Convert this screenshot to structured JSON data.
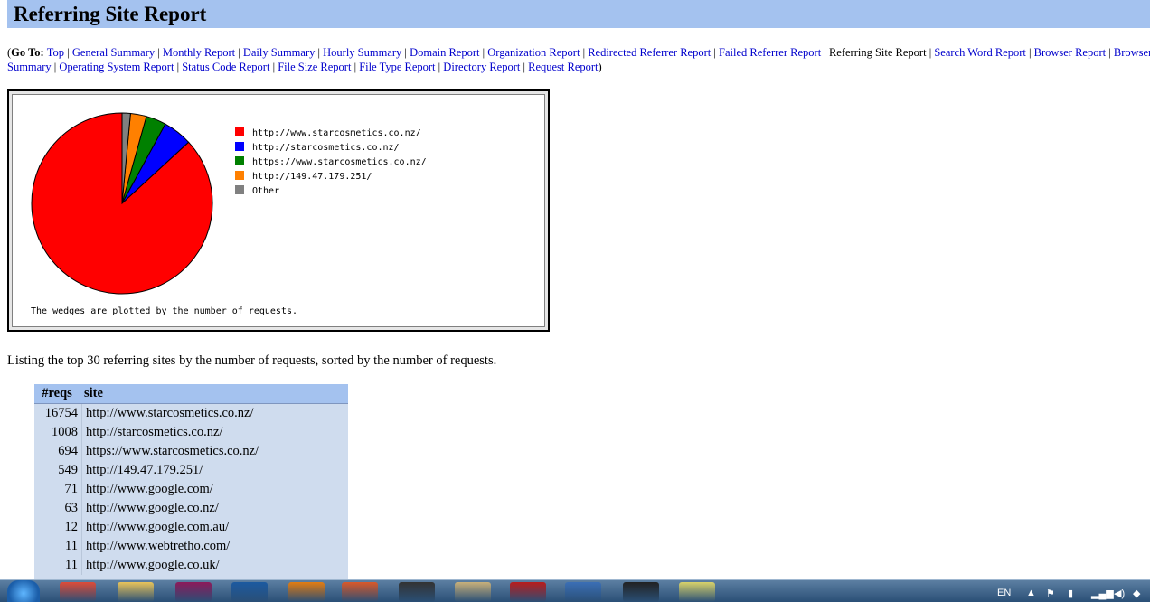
{
  "header": {
    "title": "Referring Site Report"
  },
  "goto": {
    "prefix": "(",
    "label": "Go To",
    "colon": ":",
    "suffix": ")",
    "separator": " | ",
    "line1": [
      {
        "label": "Top",
        "link": true
      },
      {
        "label": "General Summary",
        "link": true
      },
      {
        "label": "Monthly Report",
        "link": true
      },
      {
        "label": "Daily Summary",
        "link": true
      },
      {
        "label": "Hourly Summary",
        "link": true
      },
      {
        "label": "Domain Report",
        "link": true
      },
      {
        "label": "Organization Report",
        "link": true
      },
      {
        "label": "Redirected Referrer Report",
        "link": true
      },
      {
        "label": "Failed Referrer Report",
        "link": true
      },
      {
        "label": "Referring Site Report",
        "link": false
      },
      {
        "label": "Search Word Report",
        "link": true
      },
      {
        "label": "Browser Report",
        "link": true
      },
      {
        "label": "Browser",
        "link": true
      }
    ],
    "line2": [
      {
        "label": "Summary",
        "link": true
      },
      {
        "label": "Operating System Report",
        "link": true
      },
      {
        "label": "Status Code Report",
        "link": true
      },
      {
        "label": "File Size Report",
        "link": true
      },
      {
        "label": "File Type Report",
        "link": true
      },
      {
        "label": "Directory Report",
        "link": true
      },
      {
        "label": "Request Report",
        "link": true
      }
    ]
  },
  "chart_data": {
    "type": "pie",
    "title": "",
    "note": "The wedges are plotted by the number of requests.",
    "slices": [
      {
        "label": "http://www.starcosmetics.co.nz/",
        "value": 16754,
        "color": "#ff0000"
      },
      {
        "label": "http://starcosmetics.co.nz/",
        "value": 1008,
        "color": "#0000ff"
      },
      {
        "label": "https://www.starcosmetics.co.nz/",
        "value": 694,
        "color": "#008000"
      },
      {
        "label": "http://149.47.179.251/",
        "value": 549,
        "color": "#ff8000"
      },
      {
        "label": "Other",
        "value": 289,
        "color": "#808080"
      }
    ]
  },
  "intro": "Listing the top 30 referring sites by the number of requests, sorted by the number of requests.",
  "table": {
    "headers": [
      "#reqs",
      "site"
    ],
    "rows": [
      {
        "reqs": "16754",
        "site": "http://www.starcosmetics.co.nz/"
      },
      {
        "reqs": "1008",
        "site": "http://starcosmetics.co.nz/"
      },
      {
        "reqs": "694",
        "site": "https://www.starcosmetics.co.nz/"
      },
      {
        "reqs": "549",
        "site": "http://149.47.179.251/"
      },
      {
        "reqs": "71",
        "site": "http://www.google.com/"
      },
      {
        "reqs": "63",
        "site": "http://www.google.co.nz/"
      },
      {
        "reqs": "12",
        "site": "http://www.google.com.au/"
      },
      {
        "reqs": "11",
        "site": "http://www.webtretho.com/"
      },
      {
        "reqs": "11",
        "site": "http://www.google.co.uk/"
      }
    ]
  },
  "taskbar": {
    "language": "EN",
    "apps": [
      {
        "name": "chrome-icon",
        "color": "#dd4b39"
      },
      {
        "name": "folder-icon",
        "color": "#e8c45a"
      },
      {
        "name": "indesign-icon",
        "color": "#8c1a5a"
      },
      {
        "name": "photoshop-icon",
        "color": "#1c5aa0"
      },
      {
        "name": "illustrator-icon",
        "color": "#e27c12"
      },
      {
        "name": "media-player-icon",
        "color": "#d9592a"
      },
      {
        "name": "clapperboard-icon",
        "color": "#333333"
      },
      {
        "name": "alpha-book-icon",
        "color": "#c8b07a"
      },
      {
        "name": "ninja-icon",
        "color": "#b81d1d"
      },
      {
        "name": "keyboard-icon",
        "color": "#3b6fb5"
      },
      {
        "name": "unity-icon",
        "color": "#222222"
      },
      {
        "name": "notepad-icon",
        "color": "#d8d26a"
      }
    ]
  }
}
